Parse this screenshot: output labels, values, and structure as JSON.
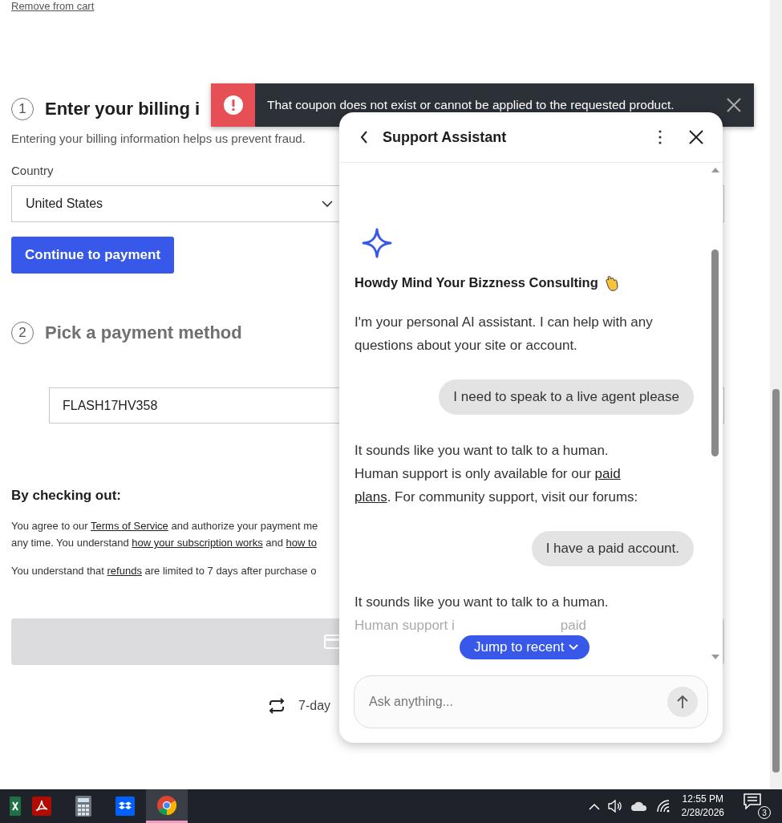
{
  "page": {
    "remove_link": "Remove from cart",
    "steps": [
      {
        "number": "1",
        "title": "Enter your billing i",
        "active": true
      },
      {
        "number": "2",
        "title": "Pick a payment method",
        "active": false
      }
    ],
    "billing_note": "Entering your billing information helps us prevent fraud.",
    "country": {
      "label": "Country",
      "value": "United States"
    },
    "continue_button": "Continue to payment",
    "coupon": {
      "value": "FLASH17HV358"
    },
    "terms": {
      "heading": "By checking out:",
      "paragraphs": [
        {
          "lines": [
            [
              {
                "text": "You agree to our ",
                "kind": "text"
              },
              {
                "text": "Terms of Service",
                "kind": "link"
              },
              {
                "text": " and authorize your payment me",
                "kind": "text"
              }
            ],
            [
              {
                "text": "any time. You understand ",
                "kind": "text"
              },
              {
                "text": "how your subscription works",
                "kind": "link"
              },
              {
                "text": " and ",
                "kind": "text"
              },
              {
                "text": "how to",
                "kind": "link"
              }
            ]
          ]
        },
        {
          "lines": [
            [
              {
                "text": "You understand that ",
                "kind": "text"
              },
              {
                "text": "refunds",
                "kind": "link"
              },
              {
                "text": " are limited to 7 days after purchase o",
                "kind": "text"
              }
            ]
          ]
        }
      ]
    },
    "checkout_button": {
      "disabled": true
    },
    "guarantee": "7-day"
  },
  "toast": {
    "kind": "error",
    "message": "That coupon does not exist or cannot be applied to the requested product."
  },
  "chat": {
    "title": "Support Assistant",
    "greeting": "Howdy Mind Your Bizzness Consulting",
    "messages": [
      {
        "kind": "bot",
        "lines": [
          [
            {
              "text": "I'm your personal AI assistant. I can help with any",
              "kind": "text"
            }
          ],
          [
            {
              "text": "questions about your site or account.",
              "kind": "text"
            }
          ]
        ]
      },
      {
        "kind": "user",
        "lines": [
          [
            {
              "text": "I need to speak to a live agent please",
              "kind": "text"
            }
          ]
        ]
      },
      {
        "kind": "bot",
        "lines": [
          [
            {
              "text": "It sounds like you want to talk to a human.",
              "kind": "text"
            }
          ],
          [
            {
              "text": "Human support is only available for our ",
              "kind": "text"
            },
            {
              "text": "paid",
              "kind": "link"
            }
          ],
          [
            {
              "text": "plans",
              "kind": "link"
            },
            {
              "text": ". For community support, visit our forums:",
              "kind": "text"
            }
          ]
        ]
      },
      {
        "kind": "user",
        "lines": [
          [
            {
              "text": "I have a paid account.",
              "kind": "text"
            }
          ]
        ]
      },
      {
        "kind": "bot",
        "lines": [
          [
            {
              "text": "It sounds like you want to talk to a human.",
              "kind": "text"
            }
          ]
        ],
        "cut_line": {
          "left": "Human support i",
          "right": "paid"
        }
      }
    ],
    "jump_button": "Jump to recent",
    "input": {
      "placeholder": "Ask anything..."
    }
  },
  "taskbar": {
    "apps": [
      {
        "kind": "spreadsheet",
        "selected": false
      },
      {
        "kind": "pdf",
        "selected": false
      },
      {
        "kind": "calculator",
        "selected": false
      },
      {
        "kind": "dropbox",
        "selected": false
      },
      {
        "kind": "browser",
        "selected": true
      }
    ],
    "time": "12:55 PM",
    "date": "2/28/2026",
    "notifications": "3"
  }
}
